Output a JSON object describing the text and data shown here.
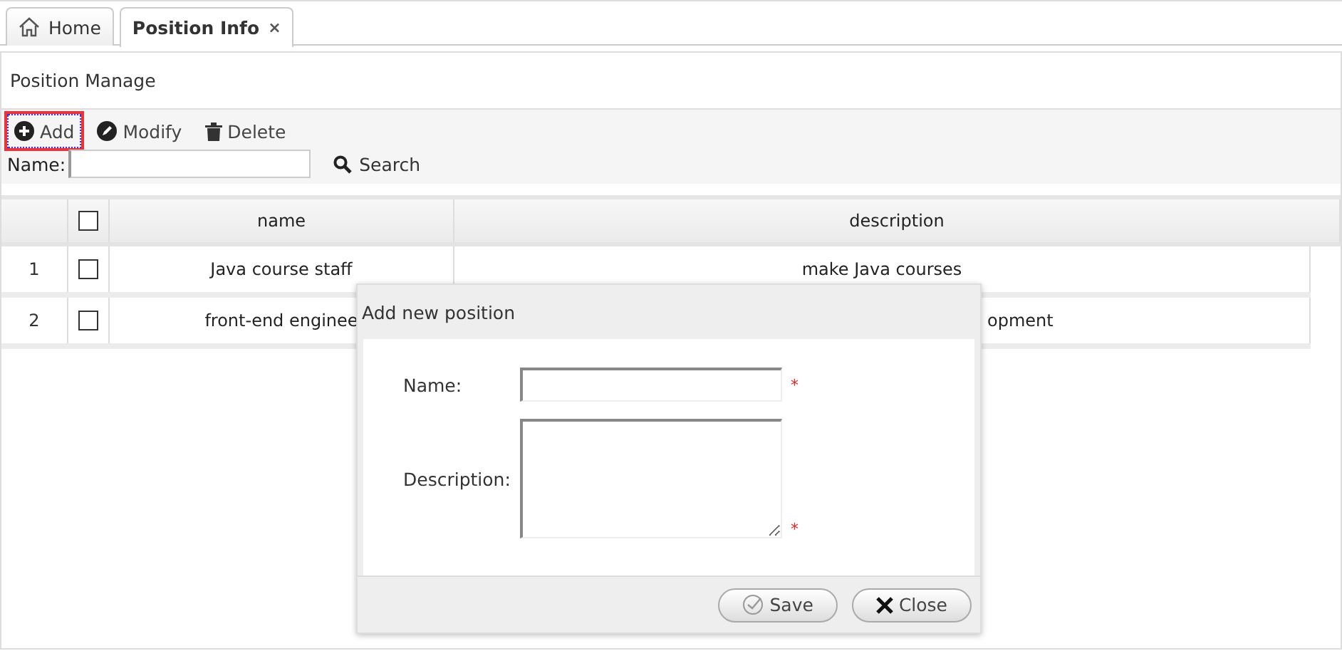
{
  "tabs": [
    {
      "label": "Home",
      "kind": "home",
      "selected": false
    },
    {
      "label": "Position Info",
      "kind": "closable",
      "close": "×",
      "selected": true
    }
  ],
  "panel": {
    "title": "Position Manage"
  },
  "toolbar": [
    {
      "label": "Add",
      "kind": "add",
      "focused": true
    },
    {
      "label": "Modify",
      "kind": "modify",
      "focused": false
    },
    {
      "label": "Delete",
      "kind": "delete",
      "focused": false
    }
  ],
  "search": {
    "label": "Name:",
    "button": "Search"
  },
  "table": {
    "columns": [
      "name",
      "description"
    ],
    "header_checked": false,
    "rows": [
      {
        "number": "1",
        "checked": false,
        "cells": [
          "Java course staff",
          "make Java courses"
        ],
        "covered": false
      },
      {
        "number": "2",
        "checked": false,
        "cells": [
          "front-end enginee",
          "opment"
        ],
        "covered": true
      }
    ]
  },
  "dialog": {
    "title": "Add new position",
    "fields": [
      {
        "label": "Name:",
        "kind": "text",
        "required_mark": "*"
      },
      {
        "label": "Description:",
        "kind": "textarea",
        "required_mark": "*"
      }
    ],
    "buttons": [
      {
        "label": "Save",
        "kind": "save"
      },
      {
        "label": "Close",
        "kind": "close"
      }
    ]
  }
}
